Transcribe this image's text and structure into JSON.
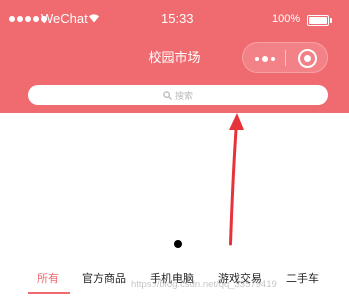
{
  "status_bar": {
    "carrier": "WeChat",
    "time": "15:33",
    "battery": "100%"
  },
  "nav": {
    "title": "校园市场"
  },
  "search": {
    "placeholder": "搜索"
  },
  "tabs": [
    {
      "label": "所有",
      "active": true
    },
    {
      "label": "官方商品",
      "active": false
    },
    {
      "label": "手机电脑",
      "active": false
    },
    {
      "label": "游戏交易",
      "active": false
    },
    {
      "label": "二手车",
      "active": false
    }
  ],
  "watermark": "https://blog.csdn.net/qq_33579419",
  "colors": {
    "brand": "#f06b70",
    "arrow": "#e8323a"
  }
}
